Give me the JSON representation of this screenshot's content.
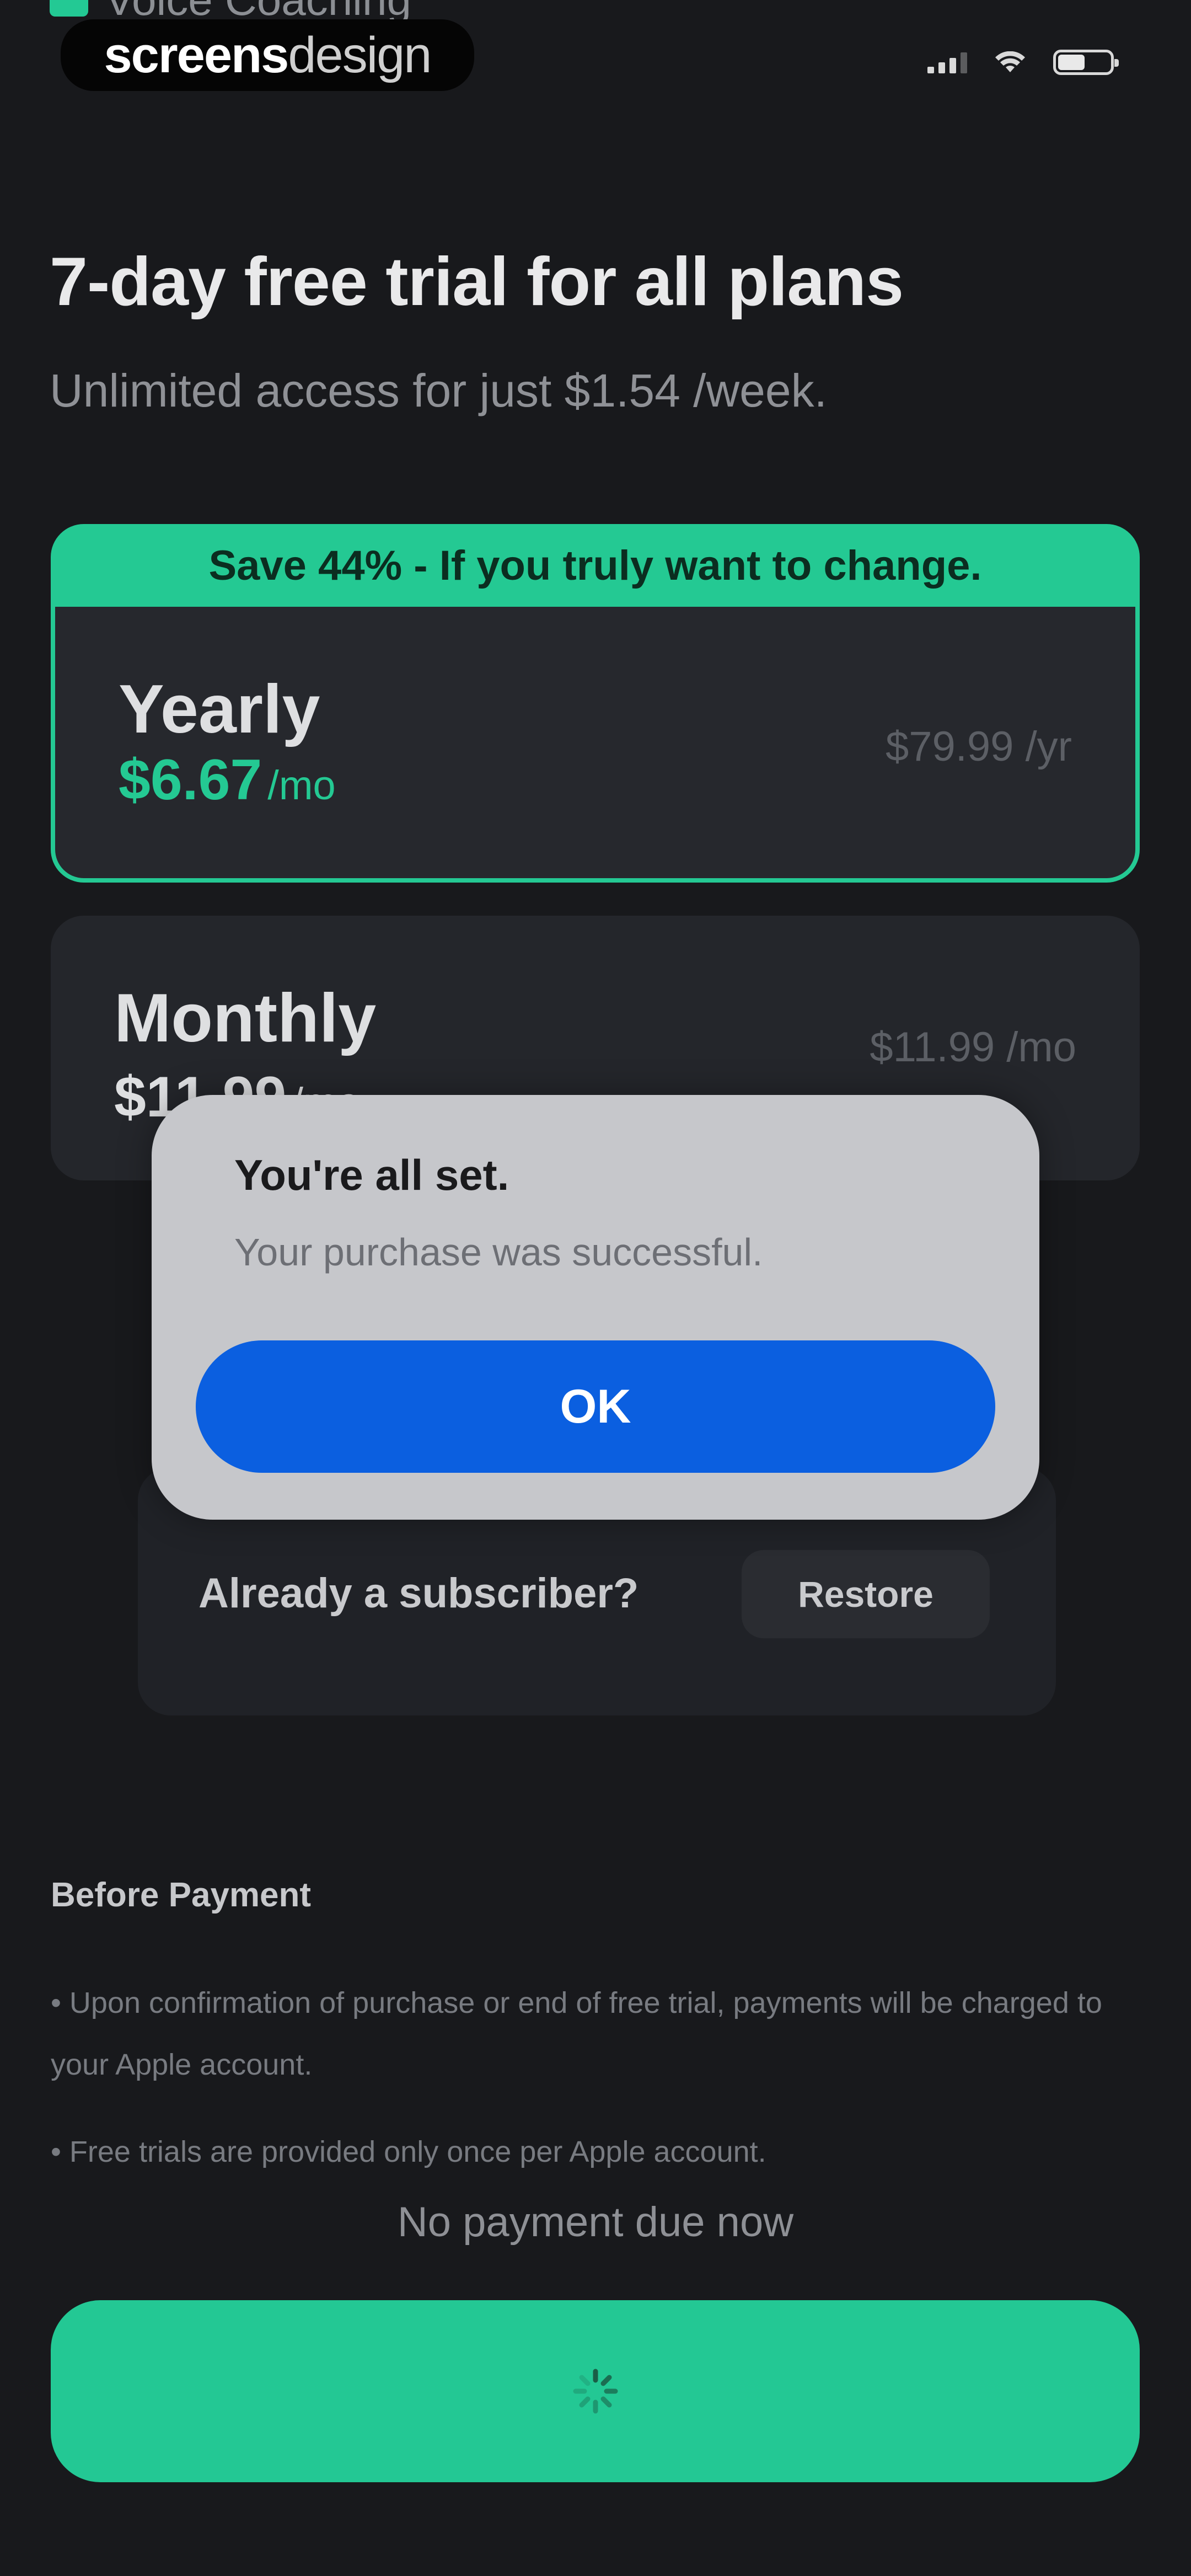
{
  "watermark": {
    "brand_bold": "screens",
    "brand_thin": "design",
    "app_name_fragment": "Voice Coaching"
  },
  "header": {
    "title": "7-day free trial for all plans",
    "subtitle": "Unlimited access for just $1.54 /week."
  },
  "plans": {
    "yearly": {
      "banner": "Save 44% - If you truly want to change.",
      "name": "Yearly",
      "price": "$6.67",
      "price_unit": "/mo",
      "total": "$79.99 /yr",
      "selected": true
    },
    "monthly": {
      "name": "Monthly",
      "price": "$11.99",
      "price_unit": "/mo",
      "total": "$11.99 /mo",
      "selected": false
    }
  },
  "restore": {
    "label": "Already a subscriber?",
    "button": "Restore"
  },
  "dialog": {
    "title": "You're all set.",
    "message": "Your purchase was successful.",
    "ok": "OK"
  },
  "legal": {
    "heading": "Before Payment",
    "line1": "• Upon confirmation of purchase or end of free trial, payments will be charged to your Apple account.",
    "line2": "• Free trials are provided only once per Apple account."
  },
  "footer": {
    "no_payment": "No payment due now"
  },
  "colors": {
    "background": "#18191c",
    "accent_green": "#24c993",
    "dialog_bg": "#c6c7cb",
    "ok_blue": "#0b5fe0"
  },
  "icons": {
    "cellular": "cellular-signal-icon",
    "wifi": "wifi-icon",
    "battery": "battery-icon",
    "loading": "loading-spinner-icon"
  }
}
